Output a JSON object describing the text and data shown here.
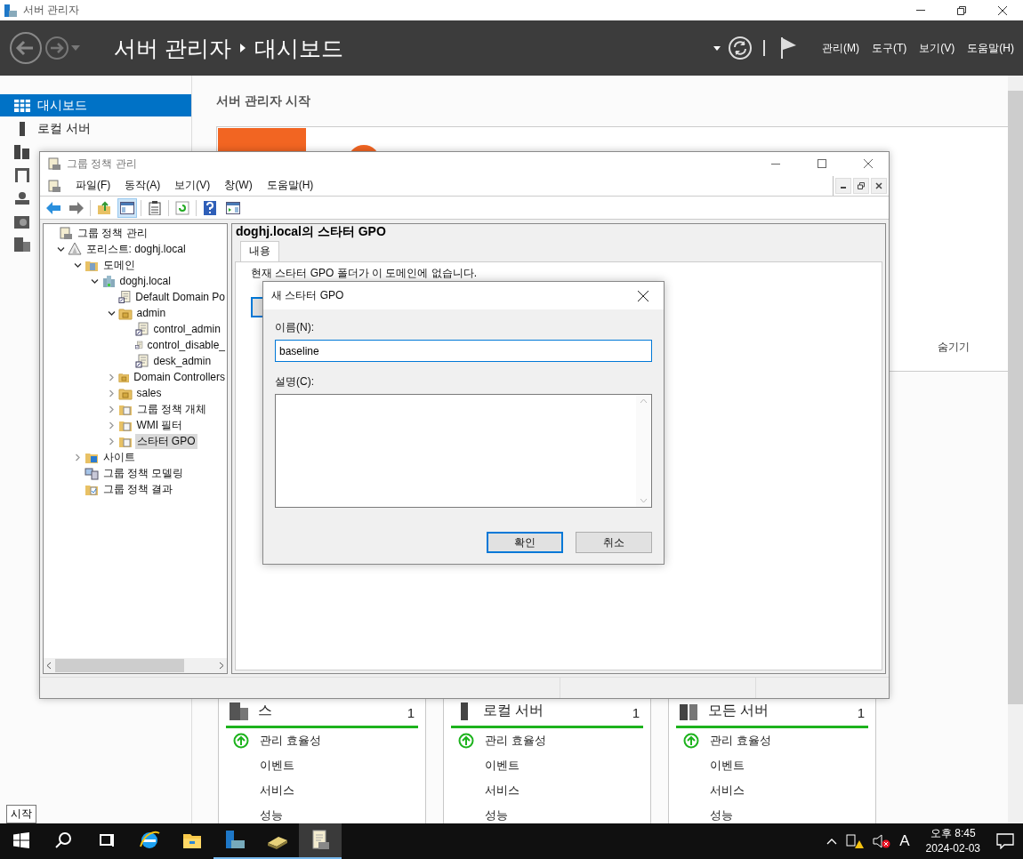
{
  "window": {
    "title": "서버 관리자"
  },
  "header": {
    "breadcrumb": [
      "서버 관리자",
      "대시보드"
    ],
    "menu": [
      "관리(M)",
      "도구(T)",
      "보기(V)",
      "도움말(H)"
    ]
  },
  "sidebar": {
    "items": [
      {
        "label": "대시보드",
        "selected": true
      },
      {
        "label": "로컬 서버",
        "selected": false
      },
      {
        "selected": false
      },
      {
        "selected": false
      },
      {
        "selected": false
      },
      {
        "selected": false
      },
      {
        "selected": false
      }
    ]
  },
  "welcome": {
    "title": "서버 관리자 시작",
    "hide": "숨기기"
  },
  "tiles": [
    {
      "title": "스",
      "count": "1",
      "rows": [
        {
          "label": "관리 효율성",
          "kind": "status"
        },
        {
          "label": "이벤트",
          "kind": "plain"
        },
        {
          "label": "서비스",
          "kind": "plain"
        },
        {
          "label": "성능",
          "kind": "plain"
        }
      ]
    },
    {
      "title": "로컬 서버",
      "count": "1",
      "rows": [
        {
          "label": "관리 효율성",
          "kind": "status"
        },
        {
          "label": "이벤트",
          "kind": "plain"
        },
        {
          "label": "서비스",
          "kind": "plain"
        },
        {
          "label": "성능",
          "kind": "plain"
        }
      ]
    },
    {
      "title": "모든 서버",
      "count": "1",
      "rows": [
        {
          "label": "관리 효율성",
          "kind": "status"
        },
        {
          "label": "이벤트",
          "kind": "plain"
        },
        {
          "label": "서비스",
          "kind": "plain"
        },
        {
          "label": "성능",
          "kind": "plain"
        }
      ]
    }
  ],
  "tooltip": "시작",
  "gpo_window": {
    "title": "그룹 정책 관리",
    "menu": [
      "파일(F)",
      "동작(A)",
      "보기(V)",
      "창(W)",
      "도움말(H)"
    ],
    "tree": [
      {
        "label": "그룹 정책 관리",
        "kind": "root",
        "selected": false,
        "children": [
          {
            "label": "포리스트: doghj.local",
            "kind": "forest",
            "expanded": true,
            "selected": false,
            "children": [
              {
                "label": "도메인",
                "kind": "domains",
                "expanded": true,
                "selected": false,
                "children": [
                  {
                    "label": "doghj.local",
                    "kind": "domain",
                    "expanded": true,
                    "selected": false,
                    "children": [
                      {
                        "label": "Default Domain Po",
                        "kind": "link",
                        "selected": false
                      },
                      {
                        "label": "admin",
                        "kind": "ou",
                        "expanded": true,
                        "selected": false,
                        "children": [
                          {
                            "label": "control_admin",
                            "kind": "link",
                            "selected": false
                          },
                          {
                            "label": "control_disable_",
                            "kind": "link",
                            "selected": false
                          },
                          {
                            "label": "desk_admin",
                            "kind": "link",
                            "selected": false
                          }
                        ]
                      },
                      {
                        "label": "Domain Controllers",
                        "kind": "ou",
                        "expanded": false,
                        "selected": false
                      },
                      {
                        "label": "sales",
                        "kind": "ou",
                        "expanded": false,
                        "selected": false
                      },
                      {
                        "label": "그룹 정책 개체",
                        "kind": "container",
                        "expanded": false,
                        "selected": false
                      },
                      {
                        "label": "WMI 필터",
                        "kind": "container",
                        "expanded": false,
                        "selected": false
                      },
                      {
                        "label": "스타터 GPO",
                        "kind": "container",
                        "expanded": false,
                        "selected": true
                      }
                    ]
                  }
                ]
              },
              {
                "label": "사이트",
                "kind": "site",
                "expanded": false,
                "selected": false
              },
              {
                "label": "그룹 정책 모델링",
                "kind": "modeling",
                "selected": false
              },
              {
                "label": "그룹 정책 결과",
                "kind": "results",
                "selected": false
              }
            ]
          }
        ]
      }
    ],
    "pane": {
      "title": "doghj.local의 스타터 GPO",
      "tabs": [
        {
          "label": "내용",
          "selected": true
        }
      ],
      "message": "현재 스타터 GPO 폴더가 이 도메인에 없습니다."
    }
  },
  "dialog": {
    "title": "새 스타터 GPO",
    "name_label": "이름(N):",
    "name_value": "baseline",
    "comment_label": "설명(C):",
    "buttons": [
      {
        "label": "확인",
        "default": true
      },
      {
        "label": "취소",
        "default": false
      }
    ]
  },
  "taskbar": {
    "apps": [
      {
        "kind": "search",
        "running": false,
        "selected": false
      },
      {
        "kind": "taskview",
        "running": false,
        "selected": false
      },
      {
        "kind": "browser",
        "running": false,
        "selected": false
      },
      {
        "kind": "folder",
        "running": false,
        "selected": false
      },
      {
        "kind": "server",
        "running": true,
        "selected": false
      },
      {
        "kind": "book",
        "running": true,
        "selected": false
      },
      {
        "kind": "scroll",
        "running": true,
        "selected": true
      }
    ],
    "ime": "A",
    "time": "오후 8:45",
    "date": "2024-02-03"
  }
}
